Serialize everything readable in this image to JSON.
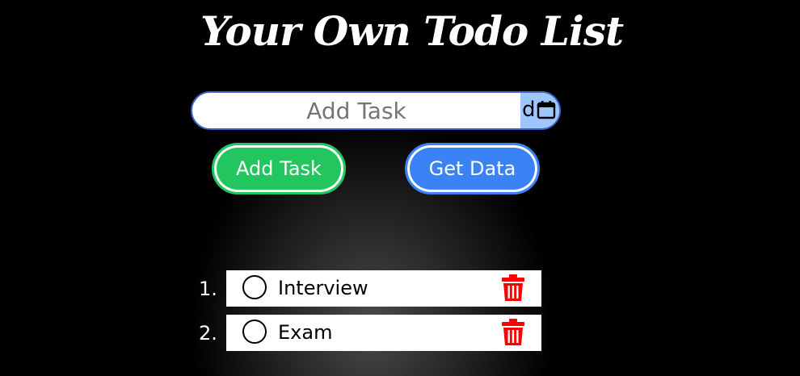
{
  "app": {
    "title": "Your Own Todo List"
  },
  "form": {
    "task_placeholder": "Add Task",
    "date_partial": "d",
    "add_button_label": "Add Task",
    "get_button_label": "Get Data"
  },
  "tasks": [
    {
      "number": "1.",
      "text": "Interview"
    },
    {
      "number": "2.",
      "text": "Exam"
    }
  ],
  "colors": {
    "add_button": "#22c55e",
    "get_button": "#3b82f6",
    "delete_icon": "#ff0000",
    "input_border": "#3b62c9",
    "date_highlight": "#9ec6ff"
  },
  "icons": {
    "date": "calendar-icon",
    "complete": "circle-icon",
    "delete": "trash-icon"
  }
}
